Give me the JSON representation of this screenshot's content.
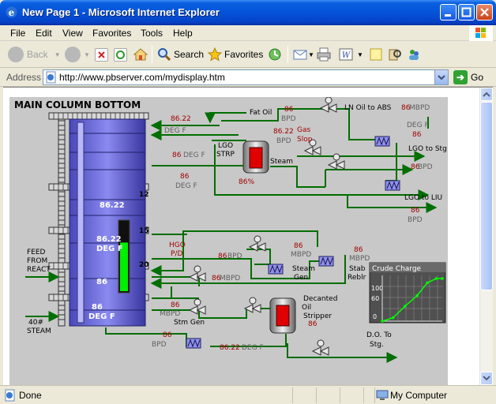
{
  "window": {
    "title": "New Page 1 - Microsoft Internet Explorer"
  },
  "menu": [
    "File",
    "Edit",
    "View",
    "Favorites",
    "Tools",
    "Help"
  ],
  "toolbar": {
    "back": "Back",
    "search": "Search",
    "favorites": "Favorites"
  },
  "address": {
    "label": "Address",
    "url": "http://www.pbserver.com/mydisplay.htm",
    "go": "Go"
  },
  "status": {
    "text": "Done",
    "zone": "My Computer"
  },
  "display": {
    "title": "MAIN COLUMN BOTTOM",
    "column": {
      "val_top": "86.22",
      "val_mid": "86.22",
      "unit_mid": "DEG F",
      "val_low": "86",
      "val_bottom": "86",
      "unit_bottom": "DEG F",
      "tray_12": "12",
      "tray_15": "15",
      "tray_20": "20",
      "level_percent": 70
    },
    "labels": {
      "fat_oil": "Fat Oil",
      "ln_oil": "LN Oil to ABS",
      "lgo_strp": "LGO",
      "lgo_strp2": "STRP",
      "steam": "Steam",
      "gas_slop": "Gas",
      "gas_slop2": "Slop",
      "lgo_stg": "LGO to Stg",
      "lgo_liu": "LGO to LIU",
      "feed1": "FEED",
      "feed2": "FROM",
      "feed3": "REACT",
      "steam40_1": "40#",
      "steam40_2": "STEAM",
      "hgo": "HGO",
      "hgo2": "P/D",
      "steam_gen": "Steam",
      "steam_gen2": "Gen",
      "stab": "Stab",
      "stab2": "Reblr",
      "stm_gen": "Stm Gen",
      "decanted": "Decanted",
      "decanted2": "Oil",
      "decanted3": "Stripper",
      "do_stg": "D.O. To",
      "do_stg2": "Stg."
    },
    "values": {
      "v1": "86.22",
      "v1u": "DEG F",
      "v2": "86",
      "v2u": "BPD",
      "v3": "86",
      "v3u": "MBPD",
      "v3b": "DEG F",
      "v3c": "86",
      "v4": "86.22",
      "v4u": "BPD",
      "v5": "86",
      "v5u": "DEG F",
      "v6": "86",
      "v6u": "BPD",
      "v7": "86",
      "v7u": "DEG F",
      "v8": "86%",
      "v9": "86",
      "v9u": "BPD",
      "v10": "86",
      "v10u": "BPD",
      "v11": "86",
      "v11u": "BPD",
      "v12": "86",
      "v12u": "MBPD",
      "v13": "86",
      "v13u": "MBPD",
      "v14": "86",
      "v14u": "MBPD",
      "v15": "86",
      "v15u": "MBPD",
      "v16": "86",
      "v16u": "DEG F",
      "v17": "86.22",
      "v17u": "DEG F",
      "v18": "86"
    },
    "chart": {
      "title": "Crude Charge",
      "yticks": [
        "100",
        "60",
        "0"
      ],
      "points": [
        [
          0,
          0
        ],
        [
          0.18,
          8
        ],
        [
          0.38,
          35
        ],
        [
          0.58,
          60
        ],
        [
          0.75,
          90
        ],
        [
          0.9,
          100
        ],
        [
          1.0,
          100
        ]
      ]
    }
  }
}
